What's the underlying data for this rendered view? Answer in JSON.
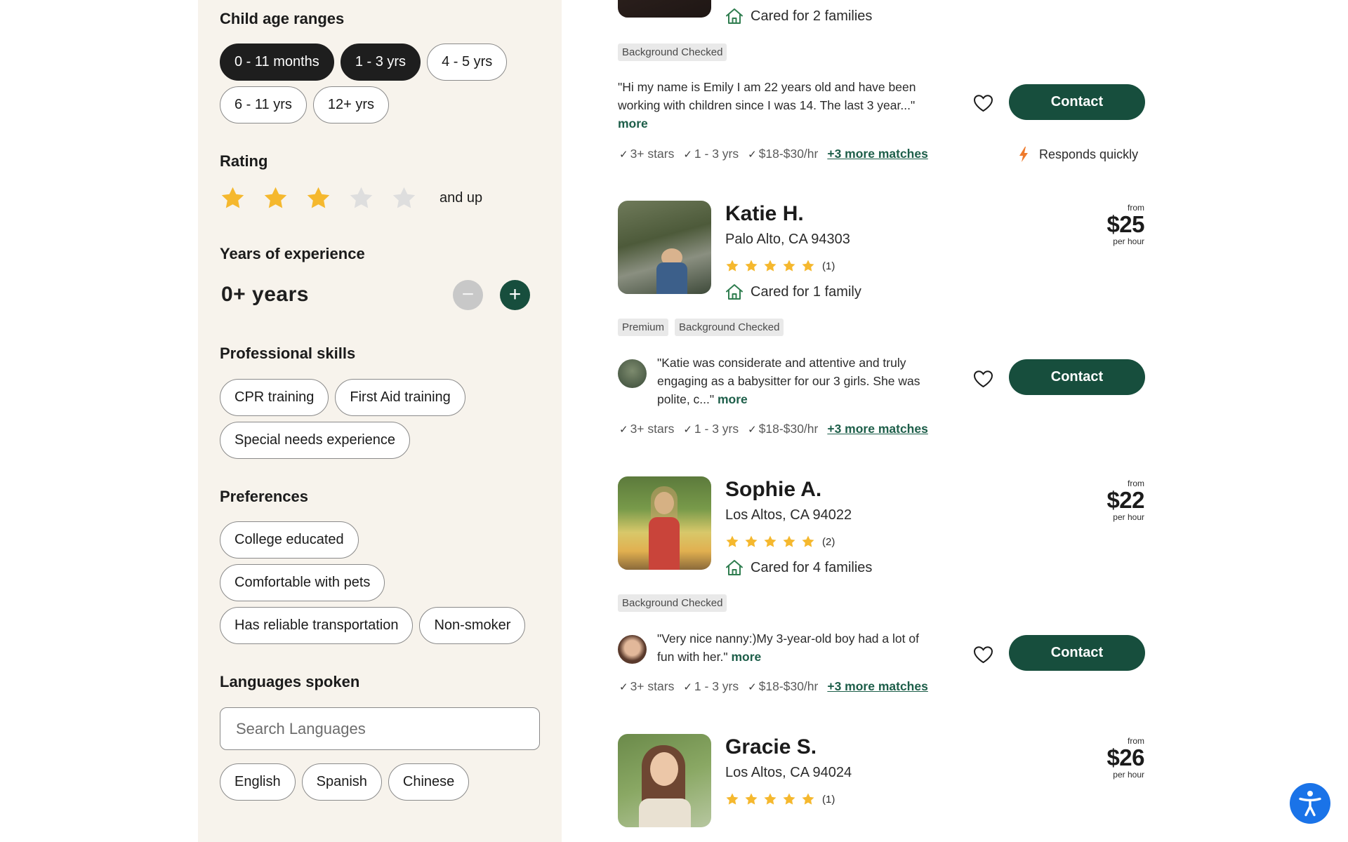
{
  "filters": {
    "child_age": {
      "title": "Child age ranges",
      "options": [
        {
          "label": "0 - 11 months",
          "selected": true
        },
        {
          "label": "1 - 3 yrs",
          "selected": true
        },
        {
          "label": "4 - 5 yrs",
          "selected": false
        },
        {
          "label": "6 - 11 yrs",
          "selected": false
        },
        {
          "label": "12+ yrs",
          "selected": false
        }
      ]
    },
    "rating": {
      "title": "Rating",
      "stars_selected": 3,
      "stars_total": 5,
      "suffix": "and up"
    },
    "experience": {
      "title": "Years of experience",
      "value": "0+ years",
      "minus": "−",
      "plus": "+"
    },
    "skills": {
      "title": "Professional skills",
      "options": [
        "CPR training",
        "First Aid training",
        "Special needs experience"
      ]
    },
    "preferences": {
      "title": "Preferences",
      "options": [
        "College educated",
        "Comfortable with pets",
        "Has reliable transportation",
        "Non-smoker"
      ]
    },
    "languages": {
      "title": "Languages spoken",
      "search_placeholder": "Search Languages",
      "options": [
        "English",
        "Spanish",
        "Chinese"
      ]
    }
  },
  "colors": {
    "accent_green": "#174e3d",
    "star": "#f5b82e",
    "sidebar_bg": "#f7f3ec",
    "a11y_blue": "#1a73e8"
  },
  "listings": [
    {
      "cared_for": "Cared for 2 families",
      "badges": [
        "Background Checked"
      ],
      "quote": "\"Hi my name is Emily I am 22 years old and have been working with children since I was 14. The last 3 year...\"",
      "more": "more",
      "contact": "Contact",
      "matches": [
        "3+ stars",
        "1 - 3 yrs",
        "$18-$30/hr"
      ],
      "more_matches": "+3 more matches",
      "responds": "Responds quickly"
    },
    {
      "name": "Katie H.",
      "location": "Palo Alto, CA 94303",
      "rating": 5,
      "reviews": "(1)",
      "cared_for": "Cared for 1 family",
      "price_from": "from",
      "price": "$25",
      "price_unit": "per hour",
      "badges": [
        "Premium",
        "Background Checked"
      ],
      "quote": "\"Katie was considerate and attentive and truly engaging as a babysitter for our 3 girls. She was polite, c...\"",
      "more": "more",
      "contact": "Contact",
      "matches": [
        "3+ stars",
        "1 - 3 yrs",
        "$18-$30/hr"
      ],
      "more_matches": "+3 more matches"
    },
    {
      "name": "Sophie A.",
      "location": "Los Altos, CA 94022",
      "rating": 5,
      "reviews": "(2)",
      "cared_for": "Cared for 4 families",
      "price_from": "from",
      "price": "$22",
      "price_unit": "per hour",
      "badges": [
        "Background Checked"
      ],
      "quote": "\"Very nice nanny:)My 3-year-old boy had a lot of fun with her.\"",
      "more": "more",
      "contact": "Contact",
      "matches": [
        "3+ stars",
        "1 - 3 yrs",
        "$18-$30/hr"
      ],
      "more_matches": "+3 more matches"
    },
    {
      "name": "Gracie S.",
      "location": "Los Altos, CA 94024",
      "rating": 5,
      "reviews": "(1)",
      "price_from": "from",
      "price": "$26",
      "price_unit": "per hour"
    }
  ]
}
